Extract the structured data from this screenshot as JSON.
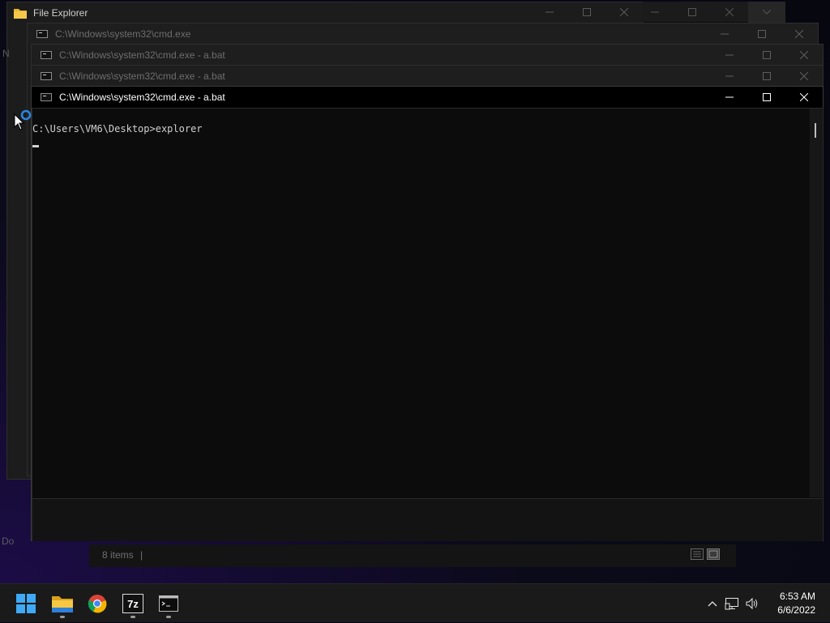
{
  "desktop": {
    "partial_label": "Do"
  },
  "explorer_window": {
    "title": "File Explorer",
    "status_items": "8 items",
    "side_letter": "N"
  },
  "cmd_windows": [
    {
      "title": "C:\\Windows\\system32\\cmd.exe"
    },
    {
      "title": "C:\\Windows\\system32\\cmd.exe - a.bat"
    },
    {
      "title": "C:\\Windows\\system32\\cmd.exe - a.bat"
    },
    {
      "title": "C:\\Windows\\system32\\cmd.exe - a.bat"
    }
  ],
  "console": {
    "line1": "C:\\Users\\VM6\\Desktop>explorer"
  },
  "taskbar": {
    "apps": [
      {
        "name": "windows-start",
        "icon": "windows-logo-icon"
      },
      {
        "name": "file-explorer",
        "icon": "folder-icon",
        "running": true
      },
      {
        "name": "chrome",
        "icon": "chrome-icon",
        "running": false
      },
      {
        "name": "7-zip",
        "icon": "7zip-icon",
        "label": "7z",
        "running": true
      },
      {
        "name": "command-prompt",
        "icon": "terminal-icon",
        "running": true
      }
    ],
    "clock": {
      "time": "6:53 AM",
      "date": "6/6/2022"
    }
  },
  "colors": {
    "accent": "#0078d4",
    "titlebar_active": "#000000",
    "console_bg": "#0c0c0c"
  }
}
